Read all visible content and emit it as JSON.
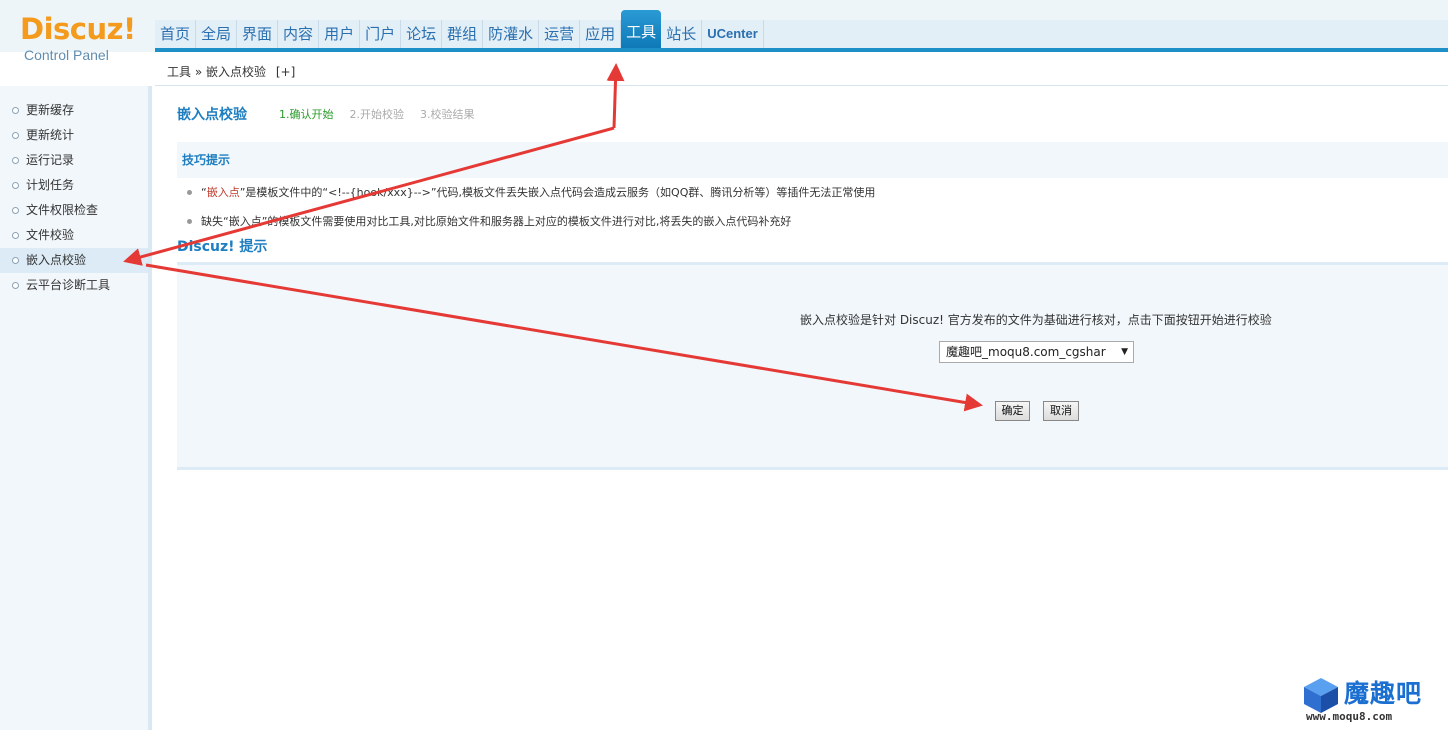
{
  "brand": {
    "logo": "Discuz!",
    "subtitle": "Control Panel"
  },
  "nav": {
    "items": [
      "首页",
      "全局",
      "界面",
      "内容",
      "用户",
      "门户",
      "论坛",
      "群组",
      "防灌水",
      "运营",
      "应用",
      "工具",
      "站长",
      "UCenter"
    ],
    "active": "工具"
  },
  "breadcrumb": {
    "section": "工具",
    "separator": "»",
    "page": "嵌入点校验",
    "add": "[+]"
  },
  "sidebar": {
    "items": [
      "更新缓存",
      "更新统计",
      "运行记录",
      "计划任务",
      "文件权限检查",
      "文件校验",
      "嵌入点校验",
      "云平台诊断工具"
    ],
    "active": "嵌入点校验"
  },
  "main": {
    "title": "嵌入点校验",
    "steps": [
      "1.确认开始",
      "2.开始校验",
      "3.校验结果"
    ],
    "tips_title": "技巧提示",
    "tips": [
      {
        "pre": "“",
        "highlight": "嵌入点",
        "post": "”是模板文件中的“<!--{hook/xxx}-->”代码,模板文件丢失嵌入点代码会造成云服务（如QQ群、腾讯分析等）等插件无法正常使用"
      },
      {
        "pre": "缺失“嵌入点”的模板文件需要使用对比工具,对比原始文件和服务器上对应的模板文件进行对比,将丢失的嵌入点代码补充好",
        "highlight": "",
        "post": ""
      }
    ],
    "notice_title": "Discuz! 提示",
    "notice_message": "嵌入点校验是针对 Discuz! 官方发布的文件为基础进行核对，点击下面按钮开始进行校验",
    "select_value": "魔趣吧_moqu8.com_cgshar",
    "confirm_label": "确定",
    "cancel_label": "取消"
  },
  "watermark": {
    "name": "魔趣吧",
    "url": "www.moqu8.com"
  },
  "colors": {
    "accent": "#1e90c8",
    "brand_orange": "#f49a1c",
    "arrow": "#e53935"
  }
}
